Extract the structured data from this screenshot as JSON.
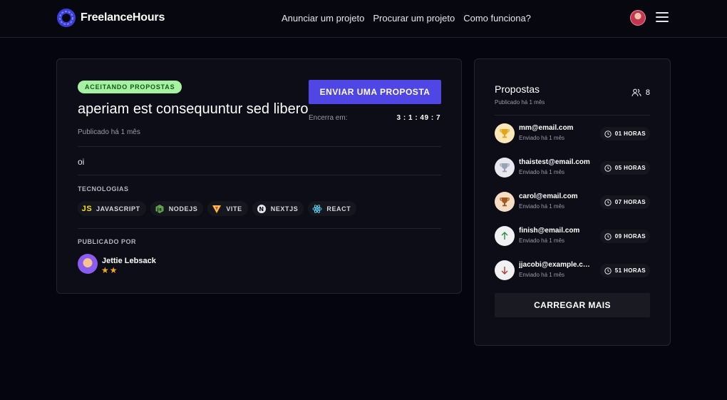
{
  "header": {
    "brand": "FreelanceHours",
    "nav": [
      "Anunciar um projeto",
      "Procurar um projeto",
      "Como funciona?"
    ]
  },
  "project": {
    "status_badge": "ACEITANDO PROPOSTAS",
    "title": "aperiam est consequuntur sed libero",
    "published": "Publicado há 1 mês",
    "cta_label": "ENVIAR UMA PROPOSTA",
    "ends_label": "Encerra em:",
    "countdown": "3 : 1 : 49 : 7",
    "description": "oi",
    "tech_heading": "TECNOLOGIAS",
    "technologies": [
      {
        "name": "JAVASCRIPT",
        "icon": "javascript-icon",
        "color": "#f7df1e"
      },
      {
        "name": "NODEJS",
        "icon": "nodejs-icon",
        "color": "#5fa04e"
      },
      {
        "name": "VITE",
        "icon": "vite-icon",
        "color": "#ffc517"
      },
      {
        "name": "NEXTJS",
        "icon": "nextjs-icon",
        "color": "#e6e6ee"
      },
      {
        "name": "REACT",
        "icon": "react-icon",
        "color": "#61dafb"
      }
    ],
    "author_heading": "PUBLICADO POR",
    "author_name": "Jettie Lebsack",
    "author_stars": "★★"
  },
  "proposals": {
    "title": "Propostas",
    "subtitle": "Publicado há 1 mês",
    "count": "8",
    "items": [
      {
        "email": "mm@email.com",
        "sent": "Enviado há 1 mês",
        "hours": "01 HORAS",
        "icon": "gold-trophy-icon"
      },
      {
        "email": "thaistest@email.com",
        "sent": "Enviado há 1 mês",
        "hours": "05 HORAS",
        "icon": "silver-trophy-icon"
      },
      {
        "email": "carol@email.com",
        "sent": "Enviado há 1 mês",
        "hours": "07 HORAS",
        "icon": "bronze-trophy-icon"
      },
      {
        "email": "finish@email.com",
        "sent": "Enviado há 1 mês",
        "hours": "09 HORAS",
        "icon": "arrow-up-icon"
      },
      {
        "email": "jjacobi@example.com",
        "sent": "Enviado há 1 mês",
        "hours": "51 HORAS",
        "icon": "arrow-down-icon"
      }
    ],
    "load_more": "CARREGAR MAIS"
  },
  "colors": {
    "accent": "#4f46e5",
    "badge_bg": "#a6f2a3",
    "star": "#f5a623",
    "background": "#050510",
    "card": "#0d0d17"
  }
}
